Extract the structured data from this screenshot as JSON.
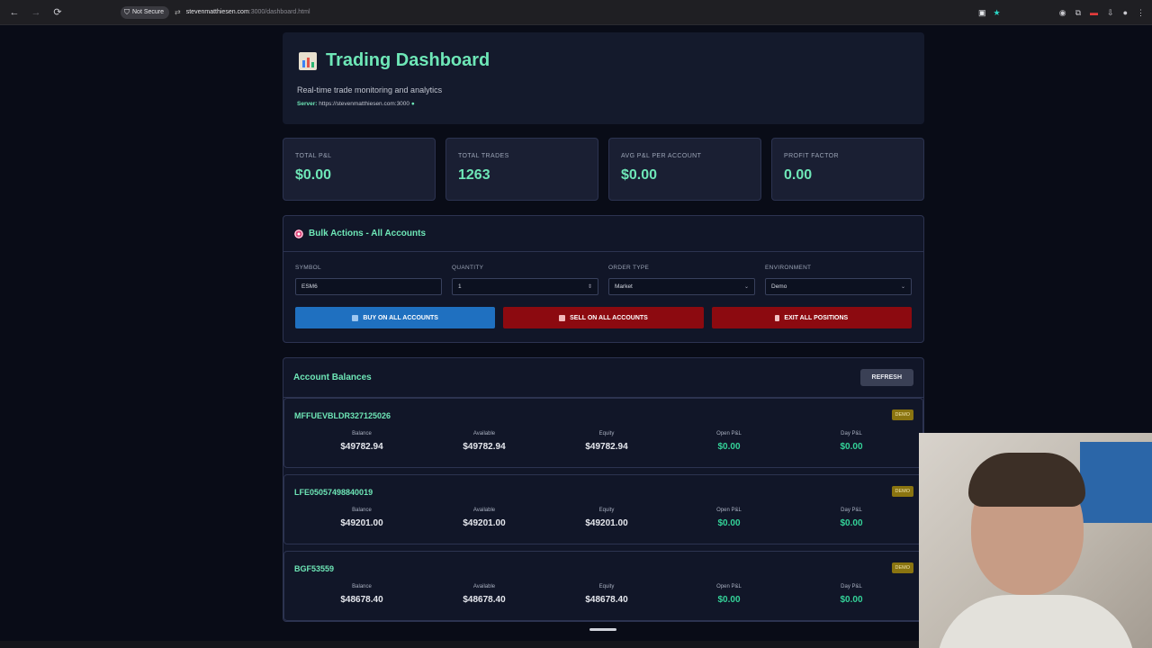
{
  "browser": {
    "not_secure": "Not Secure",
    "url_host": "stevenmatthiesen.com",
    "url_path": ":3000/dashboard.html"
  },
  "header": {
    "title": "Trading Dashboard",
    "subtitle": "Real-time trade monitoring and analytics",
    "server_label": "Server:",
    "server_url": "https://stevenmatthiesen.com:3000",
    "server_status_dot": "●"
  },
  "stats": [
    {
      "label": "TOTAL P&L",
      "value": "$0.00"
    },
    {
      "label": "TOTAL TRADES",
      "value": "1263"
    },
    {
      "label": "AVG P&L PER ACCOUNT",
      "value": "$0.00"
    },
    {
      "label": "PROFIT FACTOR",
      "value": "0.00"
    }
  ],
  "bulk": {
    "title": "Bulk Actions - All Accounts",
    "fields": {
      "symbol_label": "SYMBOL",
      "symbol_value": "ESM6",
      "quantity_label": "QUANTITY",
      "quantity_value": "1",
      "order_type_label": "ORDER TYPE",
      "order_type_value": "Market",
      "environment_label": "ENVIRONMENT",
      "environment_value": "Demo"
    },
    "buttons": {
      "buy": "BUY ON ALL ACCOUNTS",
      "sell": "SELL ON ALL ACCOUNTS",
      "exit": "EXIT ALL POSITIONS"
    }
  },
  "balances": {
    "title": "Account Balances",
    "refresh": "REFRESH",
    "column_labels": [
      "Balance",
      "Available",
      "Equity",
      "Open P&L",
      "Day P&L"
    ],
    "accounts": [
      {
        "name": "MFFUEVBLDR327125026",
        "badge": "DEMO",
        "balance": "$49782.94",
        "available": "$49782.94",
        "equity": "$49782.94",
        "open_pnl": "$0.00",
        "day_pnl": "$0.00"
      },
      {
        "name": "LFE05057498840019",
        "badge": "DEMO",
        "balance": "$49201.00",
        "available": "$49201.00",
        "equity": "$49201.00",
        "open_pnl": "$0.00",
        "day_pnl": "$0.00"
      },
      {
        "name": "BGF53559",
        "badge": "DEMO",
        "balance": "$48678.40",
        "available": "$48678.40",
        "equity": "$48678.40",
        "open_pnl": "$0.00",
        "day_pnl": "$0.00"
      }
    ]
  },
  "colors": {
    "accent_green": "#6ee7b7",
    "buy_blue": "#1f70c0",
    "sell_red": "#8c0a10",
    "demo_badge": "#8a7410"
  }
}
